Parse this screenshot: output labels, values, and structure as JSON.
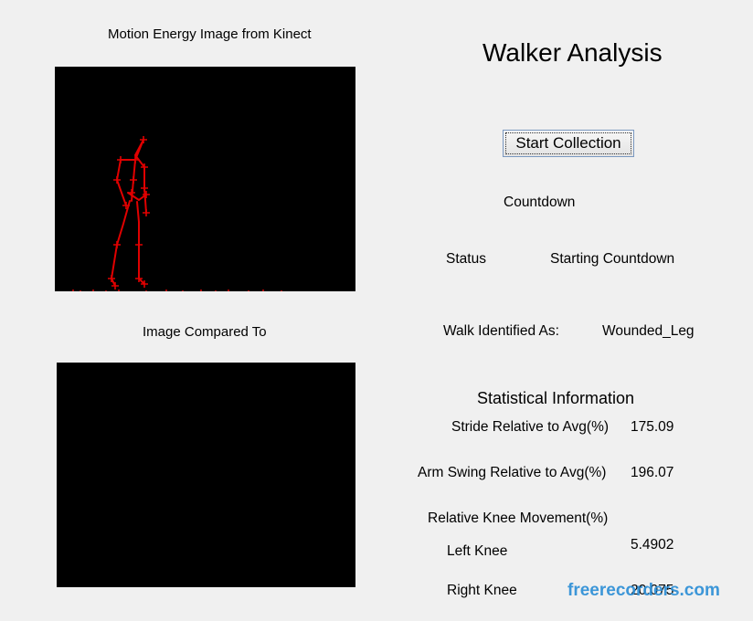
{
  "kinect_panel": {
    "caption": "Motion Energy Image from Kinect"
  },
  "compare_panel": {
    "caption": "Image Compared To"
  },
  "app": {
    "title": "Walker Analysis"
  },
  "controls": {
    "start_label": "Start Collection",
    "countdown_label": "Countdown"
  },
  "status": {
    "label": "Status",
    "value": "Starting Countdown"
  },
  "identification": {
    "label": "Walk Identified As:",
    "value": "Wounded_Leg"
  },
  "statistics": {
    "heading": "Statistical Information",
    "stride_label": "Stride Relative to Avg(%)",
    "stride_value": "175.09",
    "arm_swing_label": "Arm Swing Relative to Avg(%)",
    "arm_swing_value": "196.07",
    "knee_heading": "Relative Knee Movement(%)",
    "left_knee_label": "Left Knee",
    "left_knee_value": "5.4902",
    "right_knee_label": "Right Knee",
    "right_knee_value": "20.075"
  },
  "watermark": {
    "text": "freerecorders.com"
  },
  "colors": {
    "skeleton": "#e00000",
    "panel_background": "#000000",
    "window_background": "#f0f0f0",
    "watermark": "#2d8fd6"
  }
}
